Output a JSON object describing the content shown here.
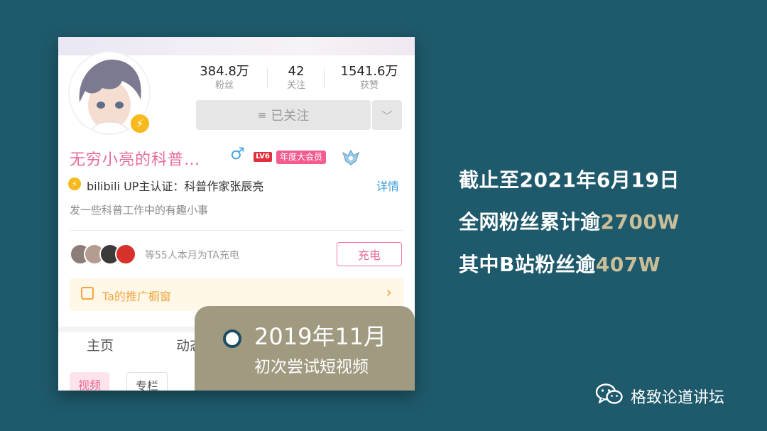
{
  "profile": {
    "stats": [
      {
        "value": "384.8万",
        "label": "粉丝"
      },
      {
        "value": "42",
        "label": "关注"
      },
      {
        "value": "1541.6万",
        "label": "获赞"
      }
    ],
    "follow_label": "已关注",
    "username": "无穷小亮的科普…",
    "gender_icon": "♂",
    "level_badge": "LV6",
    "vip_badge": "年度大会员",
    "cert_text": "bilibili UP主认证：科普作家张辰亮",
    "detail_link": "详情",
    "signature": "发一些科普工作中的有趣小事",
    "charge_text": "等55人本月为TA充电",
    "charge_button": "充电",
    "shop_label": "Ta的推广橱窗",
    "tabs": [
      "主页",
      "动态"
    ],
    "pills": [
      "视频",
      "专栏"
    ]
  },
  "timeline": {
    "date": "2019年11月",
    "caption": "初次尝试短视频"
  },
  "info": {
    "line1": "截止至2021年6月19日",
    "line2_prefix": "全网粉丝累计逾",
    "line2_value": "2700W",
    "line3_prefix": "其中B站粉丝逾",
    "line3_value": "407W"
  },
  "brand": {
    "name": "格致论道讲坛",
    "icon": "wechat-icon"
  },
  "colors": {
    "background": "#1e5a6b",
    "highlight": "#c8bf9a",
    "overlay": "#a09a80",
    "pink": "#e86a98"
  }
}
